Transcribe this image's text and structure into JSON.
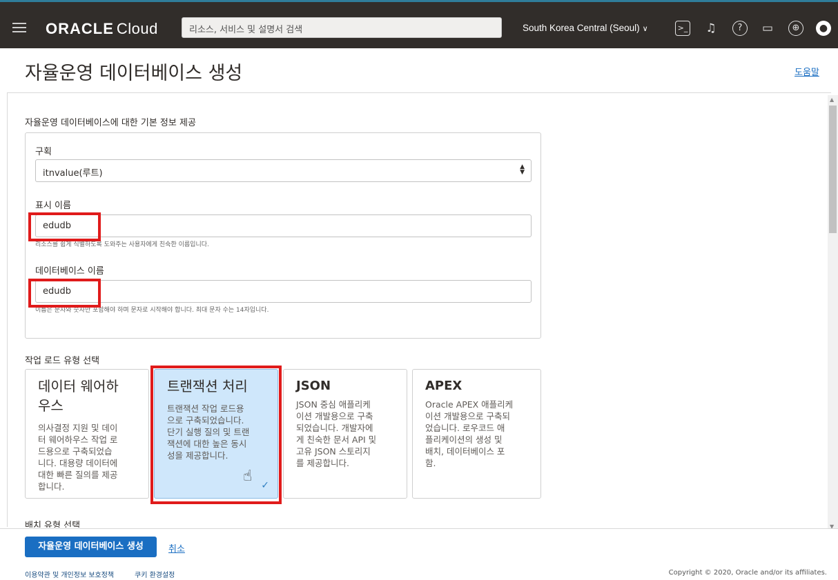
{
  "header": {
    "brand_bold": "ORACLE",
    "brand_light": "Cloud",
    "search_placeholder": "리소스, 서비스 및 설명서 검색",
    "region": "South Korea Central (Seoul)",
    "icons": [
      "terminal-icon",
      "bell-icon",
      "help-circle-icon",
      "chat-icon",
      "globe-icon",
      "user-avatar-icon"
    ]
  },
  "page": {
    "title": "자율운영 데이터베이스 생성",
    "help_link": "도움말"
  },
  "basic_info": {
    "section_title": "자율운영 데이터베이스에 대한 기본 정보 제공",
    "compartment_label": "구획",
    "compartment_value": "itnvalue(루트)",
    "display_name_label": "표시 이름",
    "display_name_value": "edudb",
    "display_name_hint": "리소스를 쉽게 식별하도록 도와주는 사용자에게 친숙한 이름입니다.",
    "db_name_label": "데이터베이스 이름",
    "db_name_value": "edudb",
    "db_name_hint": "이름은 문자와 숫자만 포함해야 하며 문자로 시작해야 합니다. 최대 문자 수는 14자입니다."
  },
  "workload": {
    "section_title": "작업 로드 유형 선택",
    "tiles": [
      {
        "title_1": "데이터 웨어하",
        "title_2": "우스",
        "desc": [
          "의사결정 지원 및 데이",
          "터 웨어하우스 작업 로",
          "드용으로 구축되었습",
          "니다. 대용량 데이터에",
          "대한 빠른 질의를 제공",
          "합니다."
        ]
      },
      {
        "title_1": "트랜잭션 처리",
        "desc": [
          "트랜잭션 작업 로드용",
          "으로 구축되었습니다.",
          "단기 실행 질의 및 트랜",
          "잭션에 대한 높은 동시",
          "성을 제공합니다."
        ]
      },
      {
        "title_1": "JSON",
        "desc": [
          "JSON 중심 애플리케",
          "이션 개발용으로 구축",
          "되었습니다. 개발자에",
          "게 친숙한 문서 API 및",
          "고유 JSON 스토리지",
          "를 제공합니다."
        ]
      },
      {
        "title_1": "APEX",
        "desc": [
          "Oracle APEX 애플리케",
          "이션 개발용으로 구축되",
          "었습니다. 로우코드 애",
          "플리케이션의 생성 및",
          "배치, 데이터베이스 포",
          "함."
        ]
      }
    ],
    "selected_index": 1
  },
  "deployment": {
    "section_title": "배치 유형 선택"
  },
  "actions": {
    "create_label": "자율운영 데이터베이스 생성",
    "cancel_label": "취소"
  },
  "footer": {
    "terms": "이용약관 및 개인정보 보호정책",
    "cookies": "쿠키 환경설정",
    "copyright": "Copyright © 2020, Oracle and/or its affiliates."
  }
}
